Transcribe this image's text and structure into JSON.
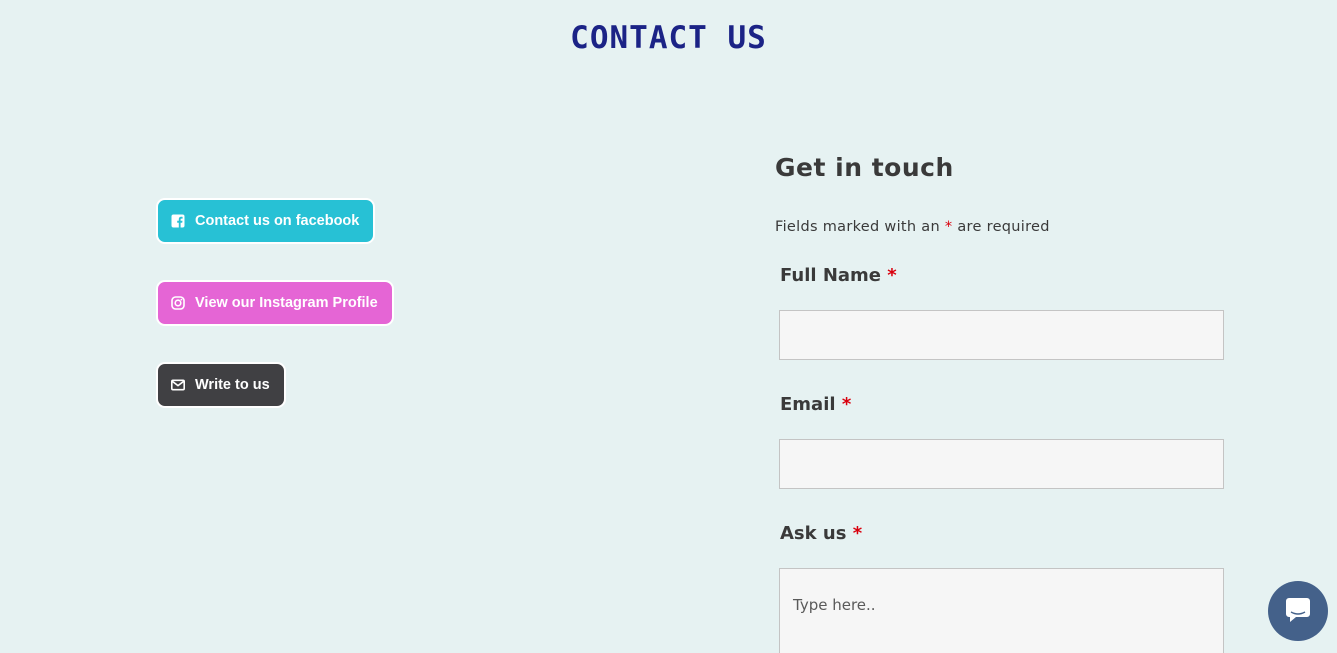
{
  "page": {
    "title": "CONTACT US"
  },
  "social": {
    "facebook": {
      "label": "Contact us on facebook",
      "icon": "facebook-square-icon",
      "color": "#27c1d5"
    },
    "instagram": {
      "label": "View our Instagram Profile",
      "icon": "instagram-icon",
      "color": "#e565d5"
    },
    "write": {
      "label": "Write to us",
      "icon": "envelope-icon",
      "color": "#404043"
    }
  },
  "form": {
    "title": "Get in touch",
    "note_prefix": "Fields marked with an",
    "note_star": "*",
    "note_suffix": "are required",
    "required_mark": "*",
    "full_name": {
      "label": "Full Name",
      "value": "",
      "placeholder": ""
    },
    "email": {
      "label": "Email",
      "value": "",
      "placeholder": ""
    },
    "ask": {
      "label": "Ask us",
      "value": "",
      "placeholder": "Type here.."
    }
  },
  "chat": {
    "icon": "chat-bubble-icon",
    "color": "#44618a"
  },
  "colors": {
    "background": "#e6f2f2",
    "title": "#1b2386",
    "required": "#d9000d"
  }
}
